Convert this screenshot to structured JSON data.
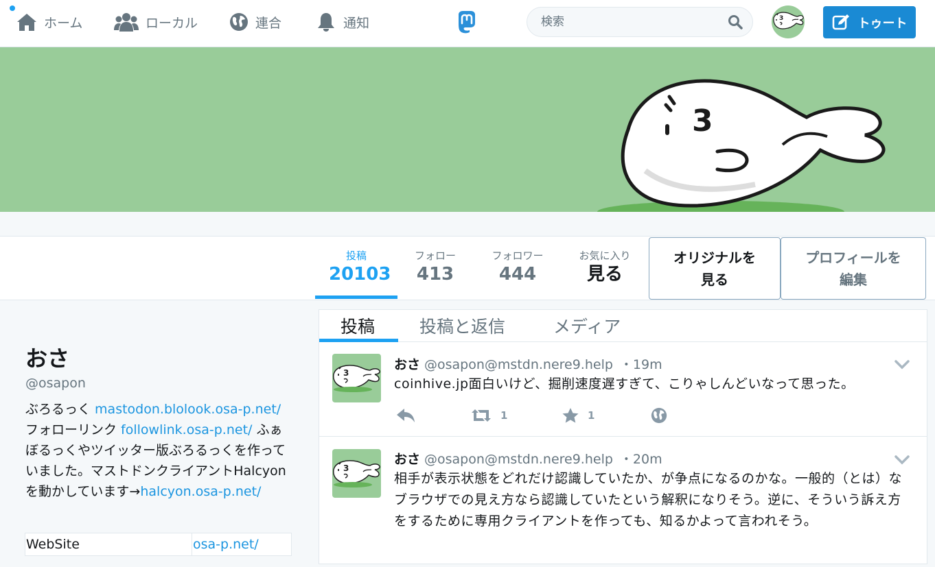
{
  "nav": {
    "home": "ホーム",
    "local": "ローカル",
    "federated": "連合",
    "notifications": "通知"
  },
  "search": {
    "placeholder": "検索"
  },
  "toot_button": "トゥート",
  "colors": {
    "accent": "#1da1f2",
    "header_bg": "#99cc99",
    "toot_button": "#1a8ad4",
    "muted": "#66757f"
  },
  "profile_nav": {
    "stats": [
      {
        "label": "投稿",
        "value": "20103"
      },
      {
        "label": "フォロー",
        "value": "413"
      },
      {
        "label": "フォロワー",
        "value": "444"
      },
      {
        "label": "お気に入り",
        "value": "見る"
      }
    ],
    "view_original": [
      "オリジナルを",
      "見る"
    ],
    "edit_profile": [
      "プロフィールを",
      "編集"
    ]
  },
  "profile": {
    "display_name": "おさ",
    "handle": "@osapon",
    "bio": {
      "t1": "ぶろるっく ",
      "link1": "mastodon.blolook.osa-p.net/",
      "t2": "フォローリンク ",
      "link2": "followlink.osa-p.net/",
      "t3": " ふぁぼるっくやツイッター版ぶろるっくを作っていました。マストドンクライアントHalcyonを動かしています→",
      "link3": "halcyon.osa-p.net/"
    },
    "fields": [
      {
        "name": "WebSite",
        "value": "osa-p.net/"
      }
    ]
  },
  "timeline": {
    "tabs": [
      "投稿",
      "投稿と返信",
      "メディア"
    ],
    "statuses": [
      {
        "display_name": "おさ",
        "acct": "@osapon@mstdn.nere9.help",
        "time": "・19m",
        "content": "coinhive.jp面白いけど、掘削速度遅すぎて、こりゃしんどいなって思った。",
        "reblogs": "1",
        "favourites": "1"
      },
      {
        "display_name": "おさ",
        "acct": "@osapon@mstdn.nere9.help",
        "time": "・20m",
        "content": "相手が表示状態をどれだけ認識していたか、が争点になるのかな。一般的（とは）なブラウザでの見え方なら認識していたという解釈になりそう。逆に、そういう訴え方をするために専用クライアントを作っても、知るかよって言われそう。"
      }
    ]
  }
}
